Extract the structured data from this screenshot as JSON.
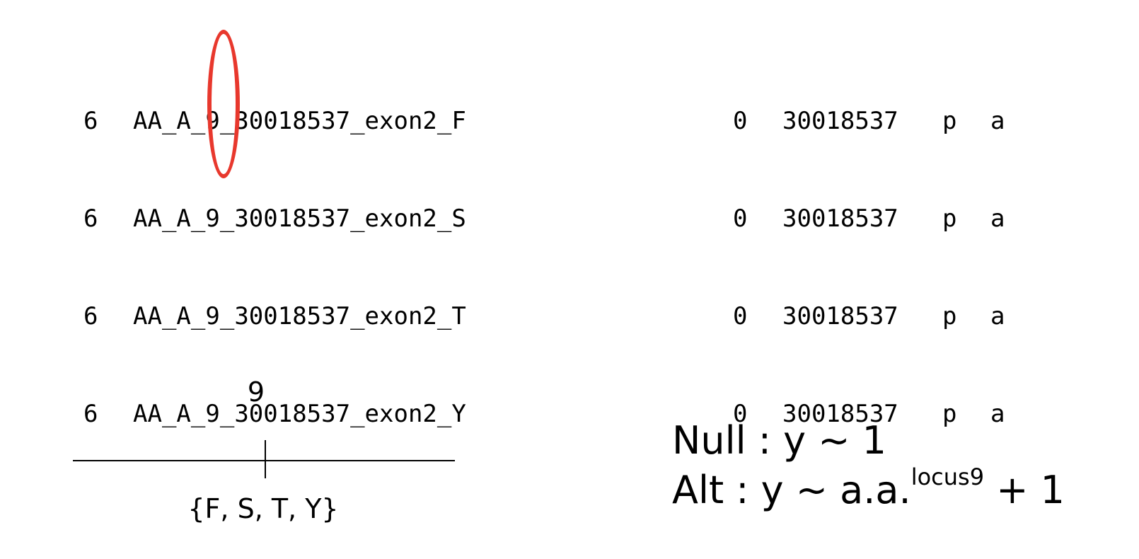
{
  "table_left": {
    "rows": [
      {
        "chr": "6",
        "name_prefix": "AA_A_",
        "locus": "9",
        "name_suffix": "_30018537_exon2_F"
      },
      {
        "chr": "6",
        "name_prefix": "AA_A_",
        "locus": "9",
        "name_suffix": "_30018537_exon2_S"
      },
      {
        "chr": "6",
        "name_prefix": "AA_A_",
        "locus": "9",
        "name_suffix": "_30018537_exon2_T"
      },
      {
        "chr": "6",
        "name_prefix": "AA_A_",
        "locus": "9",
        "name_suffix": "_30018537_exon2_Y"
      }
    ]
  },
  "table_right": {
    "rows": [
      {
        "zero": "0",
        "pos": "30018537",
        "a1": "p",
        "a2": "a"
      },
      {
        "zero": "0",
        "pos": "30018537",
        "a1": "p",
        "a2": "a"
      },
      {
        "zero": "0",
        "pos": "30018537",
        "a1": "p",
        "a2": "a"
      },
      {
        "zero": "0",
        "pos": "30018537",
        "a1": "p",
        "a2": "a"
      }
    ]
  },
  "highlight": {
    "color": "#e8382d"
  },
  "locus_diagram": {
    "locus_label": "9",
    "allele_set": "{F, S, T, Y}"
  },
  "models": {
    "null_text": "Null : y ~ 1",
    "alt_text": "Alt : y ~ a.a.",
    "alt_superscript": "locus9",
    "alt_tail": " + 1"
  }
}
